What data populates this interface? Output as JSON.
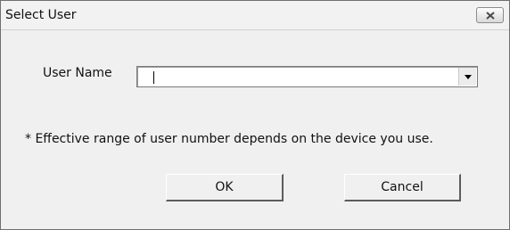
{
  "window": {
    "title": "Select User",
    "close_icon": "close-icon"
  },
  "form": {
    "user_name_label": "User Name",
    "user_name_value": "",
    "dropdown_icon": "chevron-down-icon"
  },
  "note": "* Effective range of user number depends on the device you use.",
  "buttons": {
    "ok": "OK",
    "cancel": "Cancel"
  }
}
